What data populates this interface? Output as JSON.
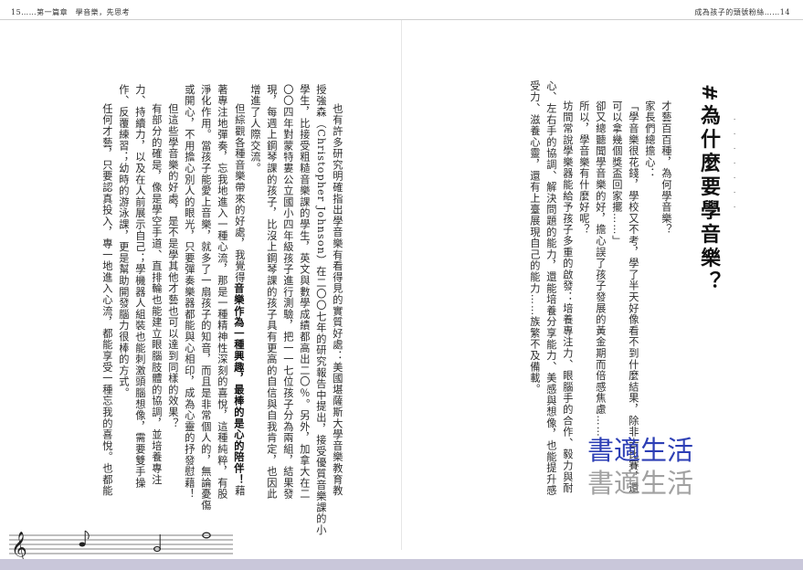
{
  "header": {
    "left": "15……第一篇章　學音樂，先思考",
    "right": "成為孩子的頭號粉絲……14"
  },
  "section": {
    "heading": "#為什麼要學音樂？"
  },
  "right_page_columns": [
    "才藝百百種，為何學音樂？",
    "家長們總擔心：",
    "「學音樂很花錢，學校又不考，學了半天好像看不到什麼結果，除非去比賽，還",
    "可以拿幾個獎盃回家擺……」",
    "卻又總聽聞學音樂的好，擔心誤了孩子發展的黃金期而倍感焦慮……",
    "所以，學音樂有什麼好呢？",
    "坊間常說學樂器能給予孩子多重的啟發：培養專注力、眼腦手的合作、毅力與耐",
    "心、左右手的協調、解決問題的能力，還能培養分享能力、美感與想像，也能提升感",
    "受力、滋養心靈，還有上臺展現自己的能力……族繁不及備載。"
  ],
  "left_page_columns": [
    "也有許多研究明確指出學音樂有看得見的實質好處：美國堪薩斯大學音樂教育教",
    "授強森（Christopher Johnson）在二〇〇七年的研究報告中提出，接受優質音樂課的小",
    "學生，比接受粗糙音樂課的學生，英文與數學成績都高出二〇％。另外，加拿大在二",
    "〇〇四年對蒙特婁公立國小四年級孩子進行測驗，把一一七位孩子分為兩組，結果發",
    "現，每週上鋼琴課的孩子，比沒上鋼琴課的孩子具有更高的自信與自我肯定，也因此",
    "增進了人際交流。",
    "但綜觀各種音樂帶來的好處，我覺得音樂作為一種興趣，最棒的是心的陪伴！藉",
    "著專注地彈奏，忘我地進入一種心流，那是一種精神性深刻的喜悅，這種純粹，有股",
    "淨化作用。當孩子能愛上音樂，就多了一扇孩子的知音，而且是非常個人的，無論憂傷",
    "或開心，不用擔心別人的眼光，只要彈奏樂器都能與心相印，成為心靈的抒發慰藉！",
    "但這些學音樂的好處，是不是學其他才藝也可以達到同樣的效果？",
    "有部分的確是，像是學空手道、直排輪也能建立眼腦肢體的協調，並培養專注",
    "力、持續力，以及在人前展示自己；學機器人組裝也能刺激頭腦想像，需要雙手操",
    "作、反覆練習；幼時的游泳課，更是幫助開發腦力很棒的方式。",
    "任何才藝，只要認真投入，專一地進入心流，都能享受一種忘我的喜悅。也都能"
  ],
  "emphasis": "音樂作為一種興趣，最棒的是心的陪伴！",
  "watermark": {
    "line1": "書適生活",
    "line2": "書適生活"
  },
  "decor": {
    "staff_icon": "music-staff-icon",
    "accent": "#2d3fb5",
    "band_color": "#c9c7da"
  }
}
